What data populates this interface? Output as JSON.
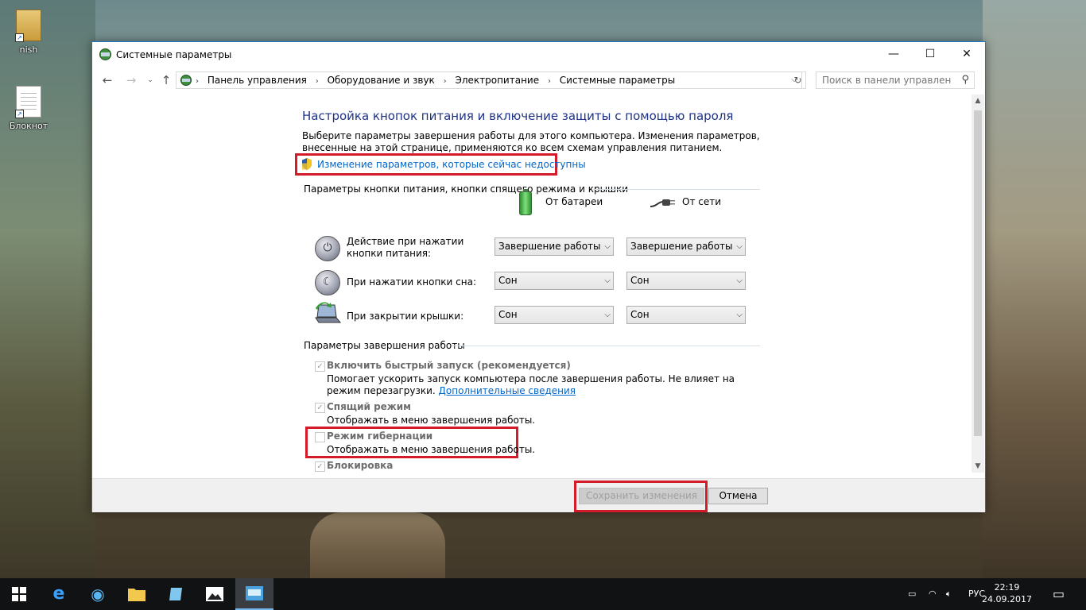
{
  "desktop": {
    "icons": [
      {
        "label": "nish"
      },
      {
        "label": "Блокнот"
      }
    ]
  },
  "window": {
    "title": "Системные параметры",
    "controls": {
      "minimize": "—",
      "maximize": "☐",
      "close": "✕"
    },
    "breadcrumb": [
      "Панель управления",
      "Оборудование и звук",
      "Электропитание",
      "Системные параметры"
    ],
    "search": {
      "placeholder": "Поиск в панели управления"
    },
    "heading": "Настройка кнопок питания и включение защиты с помощью пароля",
    "description": "Выберите параметры завершения работы для этого компьютера. Изменения параметров, внесенные на этой странице, применяются ко всем схемам управления питанием.",
    "admin_link": "Изменение параметров, которые сейчас недоступны",
    "power_group": {
      "title": "Параметры кнопки питания, кнопки спящего режима и крышки",
      "col_battery": "От батареи",
      "col_plugged": "От сети",
      "rows": [
        {
          "label": "Действие при нажатии кнопки питания:",
          "battery": "Завершение работы",
          "plugged": "Завершение работы"
        },
        {
          "label": "При нажатии кнопки сна:",
          "battery": "Сон",
          "plugged": "Сон"
        },
        {
          "label": "При закрытии крышки:",
          "battery": "Сон",
          "plugged": "Сон"
        }
      ]
    },
    "shutdown_group": {
      "title": "Параметры завершения работы",
      "items": [
        {
          "label": "Включить быстрый запуск (рекомендуется)",
          "checked": true,
          "desc": "Помогает ускорить запуск компьютера после завершения работы. Не влияет на режим перезагрузки.",
          "link": "Дополнительные сведения"
        },
        {
          "label": "Спящий режим",
          "checked": true,
          "desc": "Отображать в меню завершения работы."
        },
        {
          "label": "Режим гибернации",
          "checked": false,
          "desc": "Отображать в меню завершения работы."
        },
        {
          "label": "Блокировка",
          "checked": true
        }
      ]
    },
    "buttons": {
      "save": "Сохранить изменения",
      "cancel": "Отмена"
    }
  },
  "taskbar": {
    "language": "РУС",
    "time": "22:19",
    "date": "24.09.2017"
  },
  "colors": {
    "accent": "#1a75c9",
    "heading": "#1e3287",
    "link": "#0066cc",
    "highlight": "#d41b29"
  }
}
